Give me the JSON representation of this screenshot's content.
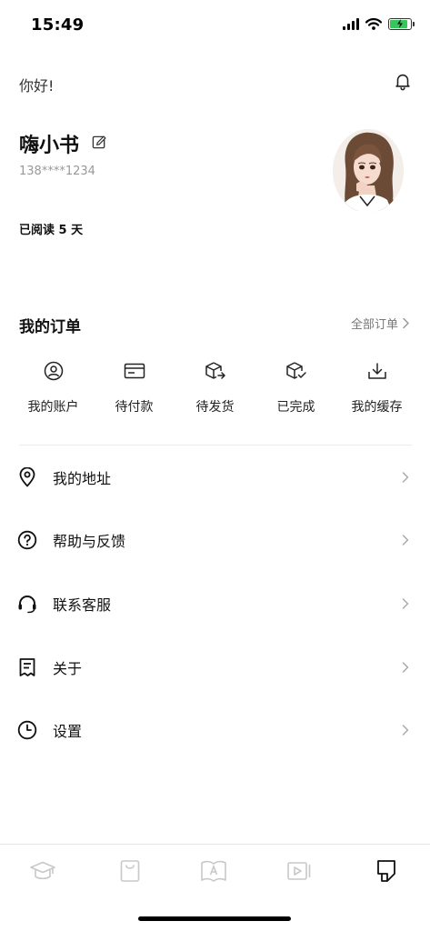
{
  "status": {
    "time": "15:49",
    "battery_level": 0.85
  },
  "header": {
    "greeting": "你好!"
  },
  "profile": {
    "name": "嗨小书",
    "phone": "138****1234",
    "read_days": "已阅读 5 天"
  },
  "orders": {
    "title": "我的订单",
    "all_label": "全部订单",
    "items": [
      {
        "label": "我的账户",
        "icon": "user-circle-icon"
      },
      {
        "label": "待付款",
        "icon": "card-icon"
      },
      {
        "label": "待发货",
        "icon": "box-arrow-icon"
      },
      {
        "label": "已完成",
        "icon": "box-check-icon"
      },
      {
        "label": "我的缓存",
        "icon": "download-icon"
      }
    ]
  },
  "menu": {
    "items": [
      {
        "label": "我的地址",
        "icon": "location-pin-icon"
      },
      {
        "label": "帮助与反馈",
        "icon": "help-circle-icon"
      },
      {
        "label": "联系客服",
        "icon": "headset-icon"
      },
      {
        "label": "关于",
        "icon": "document-icon"
      },
      {
        "label": "设置",
        "icon": "clock-icon"
      }
    ]
  },
  "tabbar": {
    "items": [
      {
        "icon": "graduation-cap-icon",
        "active": false
      },
      {
        "icon": "shopping-bag-icon",
        "active": false
      },
      {
        "icon": "open-book-icon",
        "active": false
      },
      {
        "icon": "video-icon",
        "active": false
      },
      {
        "icon": "profile-tab-icon",
        "active": true
      }
    ]
  },
  "colors": {
    "accent": "#111111",
    "inactive": "#c8c8c8",
    "battery": "#35c759"
  }
}
